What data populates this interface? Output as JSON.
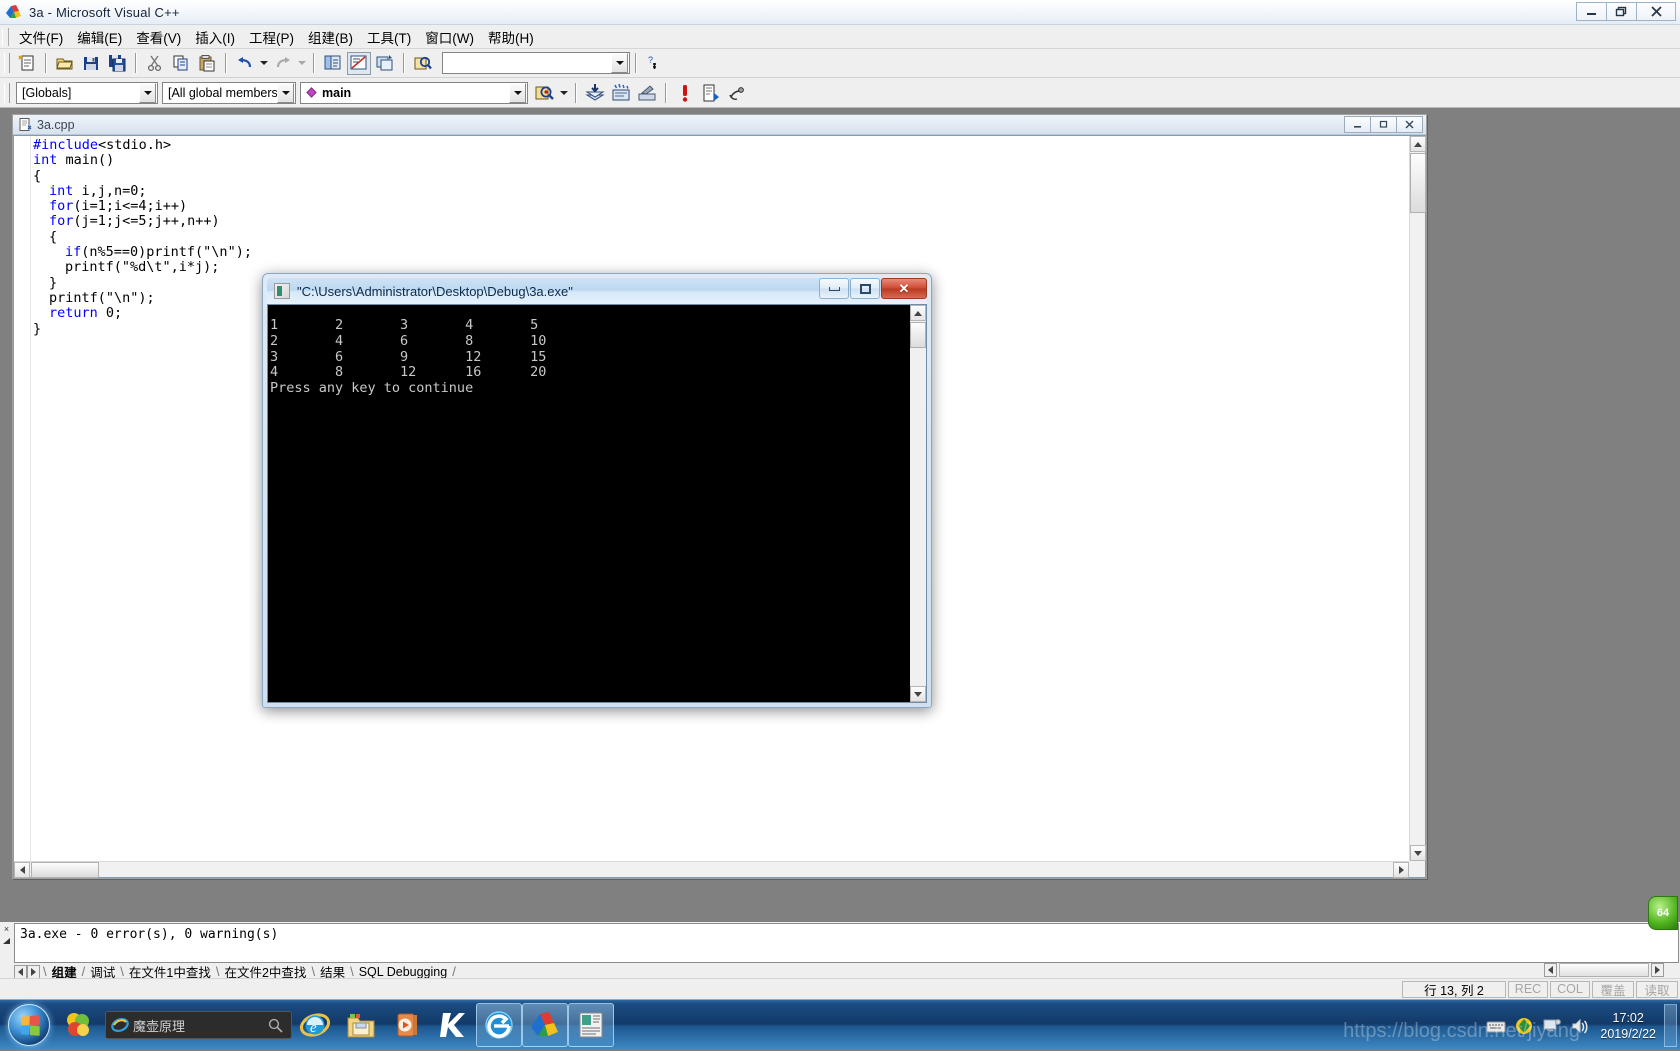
{
  "window": {
    "title": "3a - Microsoft Visual C++",
    "app_icon": "vcpp-icon",
    "caps": {
      "minimize": "─",
      "restore": "❐",
      "close": "✕"
    }
  },
  "menubar": {
    "items": [
      {
        "name": "menu-file",
        "label": "文件(F)"
      },
      {
        "name": "menu-edit",
        "label": "编辑(E)"
      },
      {
        "name": "menu-view",
        "label": "查看(V)"
      },
      {
        "name": "menu-insert",
        "label": "插入(I)"
      },
      {
        "name": "menu-project",
        "label": "工程(P)"
      },
      {
        "name": "menu-build",
        "label": "组建(B)"
      },
      {
        "name": "menu-tools",
        "label": "工具(T)"
      },
      {
        "name": "menu-window",
        "label": "窗口(W)"
      },
      {
        "name": "menu-help",
        "label": "帮助(H)"
      }
    ]
  },
  "toolbar_standard": {
    "find_placeholder": "",
    "find_value": "",
    "buttons": [
      "new-text-file-icon",
      "open-icon",
      "save-icon",
      "save-all-icon",
      "cut-icon",
      "copy-icon",
      "paste-icon",
      "undo-icon",
      "redo-icon",
      "workspace-icon",
      "output-window-icon",
      "window-list-icon",
      "find-in-files-icon",
      "find-combo",
      "context-help-icon"
    ]
  },
  "toolbar_wizard": {
    "globals_value": "[Globals]",
    "members_value": "[All global members]",
    "symbol_value": "main",
    "symbol_icon": "member-function-icon",
    "buttons": [
      "go-to-definition-icon",
      "compile-icon",
      "build-icon",
      "stop-build-icon",
      "execute-icon",
      "go-icon",
      "insert-breakpoint-icon"
    ]
  },
  "child_window": {
    "doc_icon": "cpp-file-icon",
    "title": "3a.cpp",
    "caps": {
      "minimize": "─",
      "restore": "❐",
      "close": "✕"
    },
    "code_lines": [
      {
        "indent": 0,
        "segments": [
          {
            "cls": "pp",
            "t": "#include"
          },
          {
            "cls": "",
            "t": "<stdio.h>"
          }
        ]
      },
      {
        "indent": 0,
        "segments": [
          {
            "cls": "kw",
            "t": "int"
          },
          {
            "cls": "",
            "t": " main()"
          }
        ]
      },
      {
        "indent": 0,
        "segments": [
          {
            "cls": "",
            "t": "{"
          }
        ]
      },
      {
        "indent": 1,
        "segments": [
          {
            "cls": "kw",
            "t": "int"
          },
          {
            "cls": "",
            "t": " i,j,n=0;"
          }
        ]
      },
      {
        "indent": 1,
        "segments": [
          {
            "cls": "kw",
            "t": "for"
          },
          {
            "cls": "",
            "t": "(i=1;i<=4;i++)"
          }
        ]
      },
      {
        "indent": 1,
        "segments": [
          {
            "cls": "kw",
            "t": "for"
          },
          {
            "cls": "",
            "t": "(j=1;j<=5;j++,n++)"
          }
        ]
      },
      {
        "indent": 1,
        "segments": [
          {
            "cls": "",
            "t": "{"
          }
        ]
      },
      {
        "indent": 2,
        "segments": [
          {
            "cls": "kw",
            "t": "if"
          },
          {
            "cls": "",
            "t": "(n%5==0)printf(\"\\n\");"
          }
        ]
      },
      {
        "indent": 2,
        "segments": [
          {
            "cls": "",
            "t": "printf(\"%d\\t\",i*j);"
          }
        ]
      },
      {
        "indent": 1,
        "segments": [
          {
            "cls": "",
            "t": "}"
          }
        ]
      },
      {
        "indent": 1,
        "segments": [
          {
            "cls": "",
            "t": "printf(\"\\n\");"
          }
        ]
      },
      {
        "indent": 1,
        "segments": [
          {
            "cls": "kw",
            "t": "return"
          },
          {
            "cls": "",
            "t": " 0;"
          }
        ]
      },
      {
        "indent": 0,
        "segments": [
          {
            "cls": "",
            "t": "}"
          }
        ]
      }
    ]
  },
  "console": {
    "icon": "console-app-icon",
    "title": "\"C:\\Users\\Administrator\\Desktop\\Debug\\3a.exe\"",
    "caps": {
      "minimize": "minimize-icon",
      "maximize": "maximize-icon",
      "close": "close-icon"
    },
    "output_lines": [
      "1       2       3       4       5",
      "2       4       6       8       10",
      "3       6       9       12      15",
      "4       8       12      16      20",
      "Press any key to continue"
    ]
  },
  "output_pane": {
    "close_glyph": "×",
    "build_text": "3a.exe - 0 error(s), 0 warning(s)",
    "tabs": [
      {
        "name": "tab-build",
        "label": "组建",
        "active": true
      },
      {
        "name": "tab-debug",
        "label": "调试",
        "active": false
      },
      {
        "name": "tab-find1",
        "label": "在文件1中查找",
        "active": false
      },
      {
        "name": "tab-find2",
        "label": "在文件2中查找",
        "active": false
      },
      {
        "name": "tab-results",
        "label": "结果",
        "active": false
      },
      {
        "name": "tab-sql-debug",
        "label": "SQL Debugging",
        "active": false
      }
    ]
  },
  "statusbar": {
    "message": "",
    "line_col": "行 13, 列 2",
    "indicators": [
      {
        "name": "status-rec",
        "label": "REC"
      },
      {
        "name": "status-col",
        "label": "COL"
      },
      {
        "name": "status-ovr",
        "label": "覆盖"
      },
      {
        "name": "status-read",
        "label": "读取"
      }
    ]
  },
  "taskbar": {
    "start_label": "start-orb",
    "search_value": "魔壶原理",
    "search_icon": "ie-search-icon",
    "pinned": [
      {
        "name": "taskbar-item-ie",
        "icon": "internet-explorer-icon",
        "active": false
      },
      {
        "name": "taskbar-item-explorer",
        "icon": "folder-explorer-icon",
        "active": false
      },
      {
        "name": "taskbar-item-media-player",
        "icon": "media-player-icon",
        "active": false
      },
      {
        "name": "taskbar-item-kingsoft",
        "icon": "kingsoft-icon",
        "active": false
      },
      {
        "name": "taskbar-item-browser",
        "icon": "browser-e-icon",
        "active": true
      },
      {
        "name": "taskbar-item-visual-cpp",
        "icon": "vcpp-icon",
        "active": true
      },
      {
        "name": "taskbar-item-console",
        "icon": "console-window-icon",
        "active": true
      }
    ],
    "tray": [
      {
        "name": "tray-keyboard-icon",
        "icon": "keyboard-icon"
      },
      {
        "name": "tray-antivirus-icon",
        "icon": "shield-icon"
      },
      {
        "name": "tray-network-icon",
        "icon": "network-icon"
      },
      {
        "name": "tray-volume-icon",
        "icon": "volume-icon"
      }
    ],
    "clock_time": "17:02",
    "clock_date": "2019/2/22",
    "watermark": "https://blog.csdn.net/jiyang"
  },
  "helper": {
    "label": "64"
  },
  "colors": {
    "keyword_blue": "#0000ff",
    "console_bg": "#000000",
    "console_fg": "#c8c8c8",
    "mdi_backdrop": "#808080",
    "close_red": "#cf4a32"
  }
}
